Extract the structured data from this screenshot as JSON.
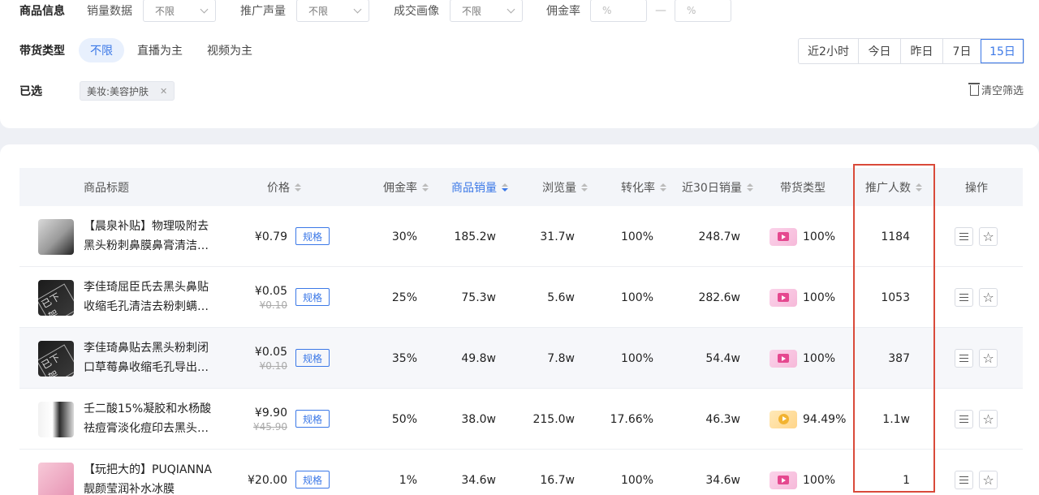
{
  "filters": {
    "title": "商品信息",
    "sales": {
      "label": "销量数据",
      "value": "不限"
    },
    "promo": {
      "label": "推广声量",
      "value": "不限"
    },
    "portrait": {
      "label": "成交画像",
      "value": "不限"
    },
    "commission": {
      "label": "佣金率",
      "min_placeholder": "%",
      "max_placeholder": "%",
      "separator": "—"
    },
    "type_title": "带货类型",
    "type_options": [
      "不限",
      "直播为主",
      "视频为主"
    ],
    "date_ranges": [
      "近2小时",
      "今日",
      "昨日",
      "7日",
      "15日"
    ],
    "date_selected": "15日",
    "selected_title": "已选",
    "selected_tags": [
      "美妆:美容护肤"
    ],
    "clear_label": "清空筛选"
  },
  "table": {
    "headers": {
      "title": "商品标题",
      "price": "价格",
      "commission": "佣金率",
      "sales": "商品销量",
      "views": "浏览量",
      "conversion": "转化率",
      "sales30": "近30日销量",
      "type": "带货类型",
      "promoters": "推广人数",
      "actions": "操作"
    },
    "sorted_column": "商品销量",
    "spec_label": "规格",
    "rows": [
      {
        "title_l1": "【晨泉补贴】物理吸附去",
        "title_l2": "黑头粉刺鼻膜鼻膏清洁…",
        "price": "¥0.79",
        "old_price": "",
        "commission": "30%",
        "sales": "185.2w",
        "views": "31.7w",
        "conversion": "100%",
        "sales30": "248.7w",
        "type_rate": "100%",
        "type_icon": "video-pink",
        "promoters": "1184"
      },
      {
        "title_l1": "李佳琦屈臣氏去黑头鼻贴",
        "title_l2": "收缩毛孔清洁去粉刺螨…",
        "price": "¥0.05",
        "old_price": "¥0.10",
        "commission": "25%",
        "sales": "75.3w",
        "views": "5.6w",
        "conversion": "100%",
        "sales30": "282.6w",
        "type_rate": "100%",
        "type_icon": "video-pink",
        "promoters": "1053",
        "thumb_text": "已下架"
      },
      {
        "title_l1": "李佳琦鼻贴去黑头粉刺闭",
        "title_l2": "口草莓鼻收缩毛孔导出…",
        "price": "¥0.05",
        "old_price": "¥0.10",
        "commission": "35%",
        "sales": "49.8w",
        "views": "7.8w",
        "conversion": "100%",
        "sales30": "54.4w",
        "type_rate": "100%",
        "type_icon": "video-pink",
        "promoters": "387",
        "thumb_text": "已下架"
      },
      {
        "title_l1": "壬二酸15%凝胶和水杨酸",
        "title_l2": "祛痘膏淡化痘印去黑头…",
        "price": "¥9.90",
        "old_price": "¥45.90",
        "commission": "50%",
        "sales": "38.0w",
        "views": "215.0w",
        "conversion": "17.66%",
        "sales30": "46.3w",
        "type_rate": "94.49%",
        "type_icon": "live-gold",
        "promoters": "1.1w"
      },
      {
        "title_l1": "【玩把大的】PUQIANNA",
        "title_l2": "靓颜莹润补水冰膜",
        "price": "¥20.00",
        "old_price": "",
        "commission": "1%",
        "sales": "34.6w",
        "views": "16.7w",
        "conversion": "100%",
        "sales30": "34.6w",
        "type_rate": "100%",
        "type_icon": "video-pink",
        "promoters": "1"
      }
    ]
  },
  "colors": {
    "accent": "#3b78e7",
    "highlight": "#d94a3a"
  }
}
